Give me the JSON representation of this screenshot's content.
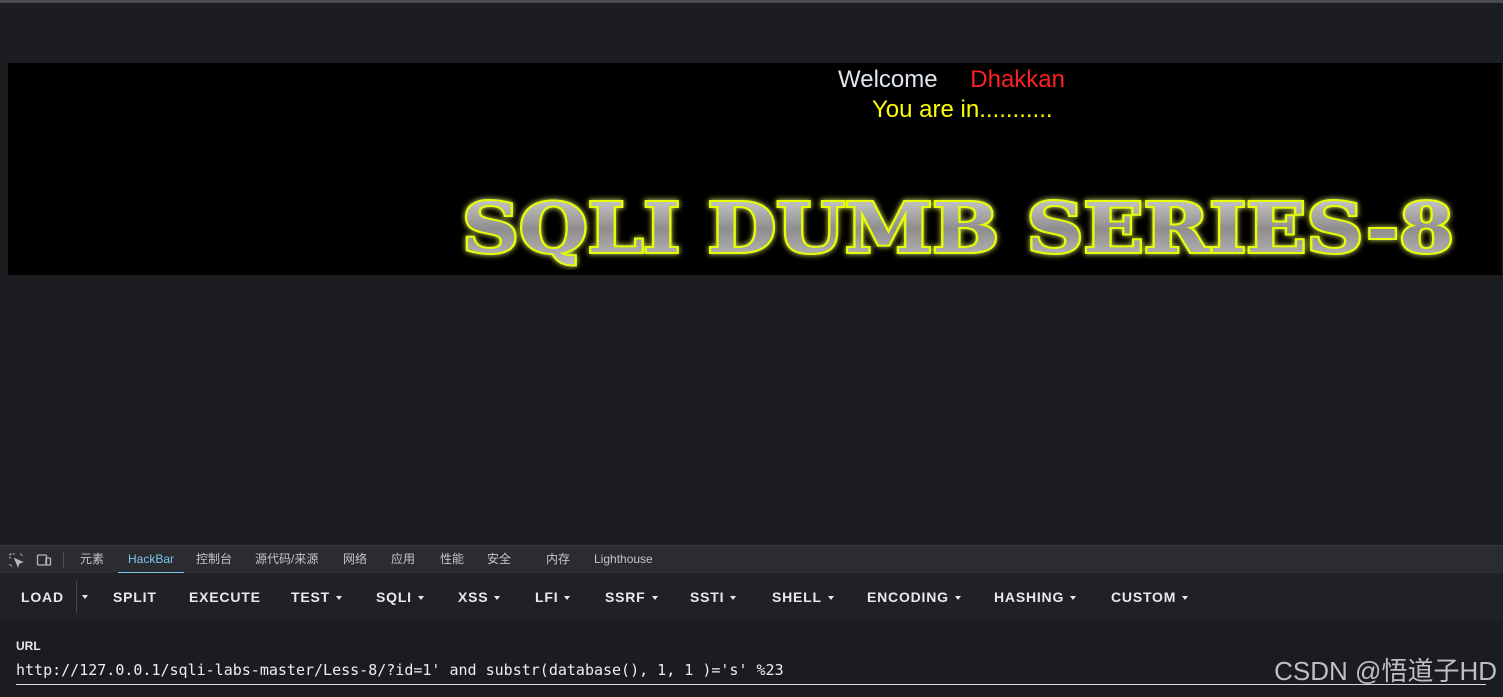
{
  "page": {
    "welcome_word": "Welcome",
    "welcome_name": "Dhakkan",
    "status_text": "You are in...........",
    "banner_title": "SQLI DUMB SERIES-8"
  },
  "devtools": {
    "tabs": [
      {
        "label": "元素"
      },
      {
        "label": "HackBar",
        "active": true
      },
      {
        "label": "控制台"
      },
      {
        "label": "源代码/来源"
      },
      {
        "label": "网络"
      },
      {
        "label": "应用"
      },
      {
        "label": "性能"
      },
      {
        "label": "安全"
      },
      {
        "label": "内存"
      },
      {
        "label": "Lighthouse"
      }
    ],
    "icons": [
      "inspect-element-icon",
      "device-toolbar-icon"
    ]
  },
  "hackbar": {
    "buttons": {
      "load": "LOAD",
      "split": "SPLIT",
      "execute": "EXECUTE",
      "test": "TEST",
      "sqli": "SQLI",
      "xss": "XSS",
      "lfi": "LFI",
      "ssrf": "SSRF",
      "ssti": "SSTI",
      "shell": "SHELL",
      "encoding": "ENCODING",
      "hashing": "HASHING",
      "custom": "CUSTOM"
    },
    "url_label": "URL",
    "url_value": "http://127.0.0.1/sqli-labs-master/Less-8/?id=1' and substr(database(), 1, 1 )='s' %23"
  },
  "watermark": "CSDN @悟道子HD",
  "colors": {
    "welcome": "#dfe6ee",
    "name": "#ff2020",
    "status": "#ffff00",
    "active_tab": "#7cc3f0",
    "banner_glow": "#e8ff00"
  }
}
